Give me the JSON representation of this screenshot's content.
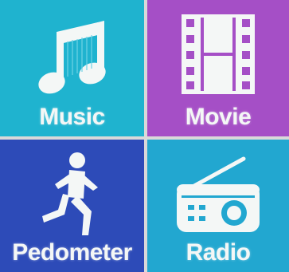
{
  "screen": {
    "background_color": "#d9d9d9"
  },
  "menu": {
    "tiles": [
      {
        "label": "Music",
        "icon": "music-note-icon",
        "color": "#1fb3cf"
      },
      {
        "label": "Movie",
        "icon": "film-strip-icon",
        "color": "#a54fc6"
      },
      {
        "label": "Pedometer",
        "icon": "running-person-icon",
        "color": "#2d4bb8"
      },
      {
        "label": "Radio",
        "icon": "radio-icon",
        "color": "#22a7d0"
      }
    ]
  }
}
